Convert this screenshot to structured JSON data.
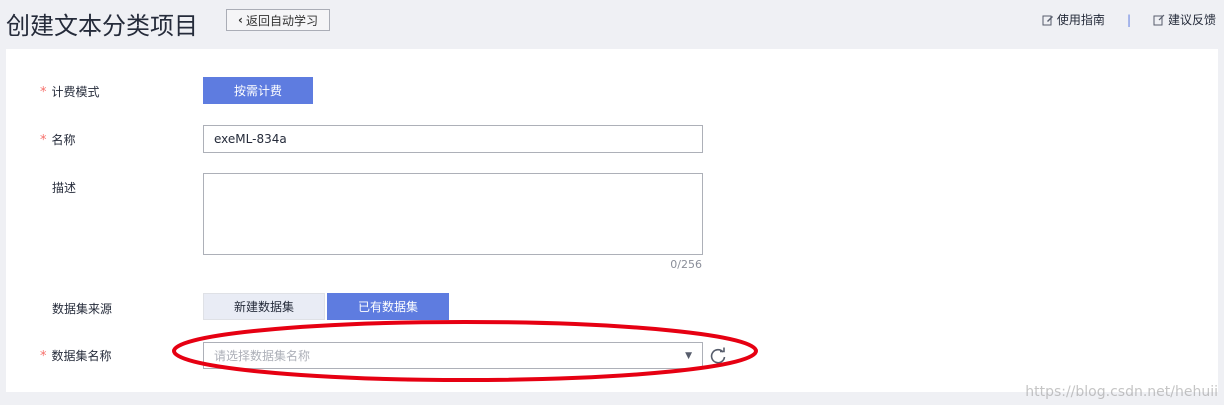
{
  "header": {
    "title": "创建文本分类项目",
    "back_label": "返回自动学习",
    "guide_label": "使用指南",
    "separator": "|",
    "feedback_label": "建议反馈"
  },
  "form": {
    "billing": {
      "label": "计费模式",
      "required": "*",
      "button": "按需计费"
    },
    "name": {
      "label": "名称",
      "required": "*",
      "value": "exeML-834a"
    },
    "description": {
      "label": "描述",
      "value": "",
      "counter": "0/256"
    },
    "dataset_source": {
      "label": "数据集来源",
      "options": [
        "新建数据集",
        "已有数据集"
      ],
      "selected": "已有数据集"
    },
    "dataset_name": {
      "label": "数据集名称",
      "required": "*",
      "placeholder": "请选择数据集名称"
    }
  },
  "colors": {
    "primary": "#5e7ce0",
    "required": "#f66f6a",
    "highlight_ellipse": "#e60012"
  },
  "watermark": "https://blog.csdn.net/hehuii"
}
